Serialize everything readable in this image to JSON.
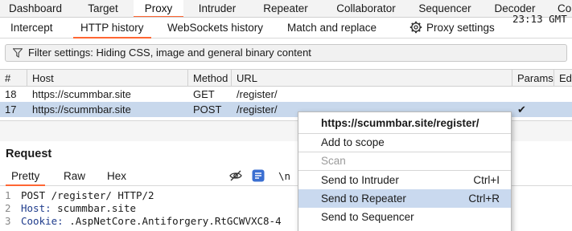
{
  "main_tabs": [
    "Dashboard",
    "Target",
    "Proxy",
    "Intruder",
    "Repeater",
    "Collaborator",
    "Sequencer",
    "Decoder",
    "Co"
  ],
  "sub_tabs": [
    "Intercept",
    "HTTP history",
    "WebSockets history",
    "Match and replace",
    "Proxy settings"
  ],
  "filter": {
    "text": "Filter settings: Hiding CSS, image and general binary content"
  },
  "table": {
    "columns": [
      "#",
      "Host",
      "Method",
      "URL",
      "Params",
      "Edi"
    ],
    "rows": [
      {
        "num": "18",
        "host": "https://scummbar.site",
        "method": "GET",
        "url": "/register/",
        "params": ""
      },
      {
        "num": "17",
        "host": "https://scummbar.site",
        "method": "POST",
        "url": "/register/",
        "params": "✔"
      }
    ]
  },
  "request": {
    "title": "Request",
    "tabs": [
      "Pretty",
      "Raw",
      "Hex"
    ],
    "newline_toggle": "\\n",
    "lines": [
      {
        "n": "1",
        "text": "POST /register/ HTTP/2"
      },
      {
        "n": "2",
        "key": "Host:",
        "value": " scummbar.site"
      },
      {
        "n": "3",
        "key": "Cookie:",
        "value": " .AspNetCore.Antiforgery.RtGCWVXC8-4"
      }
    ],
    "timestamp_fragment": "23:13 GMT"
  },
  "context_menu": {
    "header": "https://scummbar.site/register/",
    "items": [
      {
        "label": "Add to scope",
        "shortcut": "",
        "disabled": false
      },
      {
        "label": "Scan",
        "shortcut": "",
        "disabled": true
      },
      {
        "label": "Send to Intruder",
        "shortcut": "Ctrl+I",
        "disabled": false
      },
      {
        "label": "Send to Repeater",
        "shortcut": "Ctrl+R",
        "disabled": false,
        "highlighted": true
      },
      {
        "label": "Send to Sequencer",
        "shortcut": "",
        "disabled": false
      }
    ]
  },
  "colors": {
    "accent": "#ff6633",
    "selection": "#c8d8ec",
    "menu_highlight": "#c9d9ef"
  }
}
